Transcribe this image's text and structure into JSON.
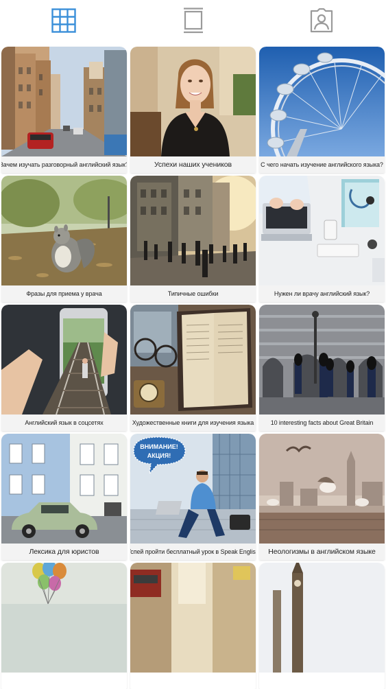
{
  "tabs": [
    {
      "name": "grid",
      "icon": "grid-icon",
      "active": true
    },
    {
      "name": "feed",
      "icon": "single-post-icon",
      "active": false
    },
    {
      "name": "tagged",
      "icon": "tagged-person-icon",
      "active": false
    }
  ],
  "colors": {
    "active_tab": "#3a8fd9",
    "inactive_tab": "#9a9a9a",
    "caption_bg": "#f3f3f3"
  },
  "posts": [
    {
      "caption": "Зачем изучать разговорный английский язык?",
      "icon": "london-street-photo"
    },
    {
      "caption": "Успехи наших учеников",
      "icon": "smiling-woman-photo"
    },
    {
      "caption": "С чего начать изучение английского языка?",
      "icon": "ferris-wheel-photo"
    },
    {
      "caption": "Фразы для приема у врача",
      "icon": "squirrel-park-photo"
    },
    {
      "caption": "Типичные ошибки",
      "icon": "crowded-street-photo"
    },
    {
      "caption": "Нужен ли врачу английский язык?",
      "icon": "doctor-desk-photo"
    },
    {
      "caption": "Английский язык в соцсетях",
      "icon": "phone-railway-photo"
    },
    {
      "caption": "Художественные книги для изучения языка",
      "icon": "old-books-glasses-photo"
    },
    {
      "caption": "10 interesting facts about Great Britain",
      "icon": "royal-guards-photo"
    },
    {
      "caption": "Лексика для юристов",
      "icon": "green-retro-car-photo"
    },
    {
      "caption": "Успей пройти бесплатный урок в Speak English",
      "icon": "man-laptop-promo-photo",
      "bubble_title": "ВНИМАНИЕ!",
      "bubble_sub": "АКЦИЯ!"
    },
    {
      "caption": "Неологизмы в английском языке",
      "icon": "seagulls-london-photo"
    },
    {
      "caption": "",
      "icon": "balloons-photo"
    },
    {
      "caption": "",
      "icon": "bus-street-photo"
    },
    {
      "caption": "",
      "icon": "big-ben-photo"
    }
  ]
}
